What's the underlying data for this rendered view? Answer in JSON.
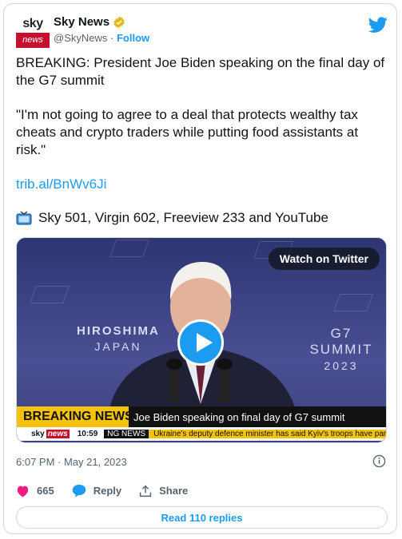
{
  "account": {
    "logo_top": "sky",
    "logo_bottom": "news",
    "name": "Sky News",
    "handle": "@SkyNews",
    "separator": "·",
    "follow_label": "Follow"
  },
  "tweet": {
    "paragraph1": "BREAKING: President Joe Biden speaking on the final day of the G7 summit",
    "paragraph2": "\"I'm not going to agree to a deal that protects wealthy tax cheats and crypto traders while putting food assistants at risk.\"",
    "link": "trib.al/BnWv6Ji",
    "channels": "Sky 501, Virgin 602, Freeview 233 and YouTube"
  },
  "media": {
    "watch_label": "Watch on Twitter",
    "backdrop_left_line1": "HIROSHIMA",
    "backdrop_left_line2": "JAPAN",
    "backdrop_right_line1": "G7 SUMMIT",
    "backdrop_right_line2": "2023",
    "breaking_label": "BREAKING NEWS",
    "headline": "Joe Biden speaking on final day of G7 summit",
    "ticker_logo_sky": "sky",
    "ticker_logo_news": "news",
    "ticker_time": "10:59",
    "ticker_tag": "NG NEWS",
    "ticker_text": "Ukraine's deputy defence minister has said Kyiv's troops have partly encirc"
  },
  "meta": {
    "timestamp": "6:07 PM · May 21, 2023"
  },
  "actions": {
    "likes": "665",
    "reply_label": "Reply",
    "share_label": "Share",
    "read_replies": "Read 110 replies"
  },
  "colors": {
    "accent": "#1d9bf0",
    "sky_red": "#c8102e",
    "breaking_yellow": "#f4c20d",
    "heart": "#f91880"
  }
}
